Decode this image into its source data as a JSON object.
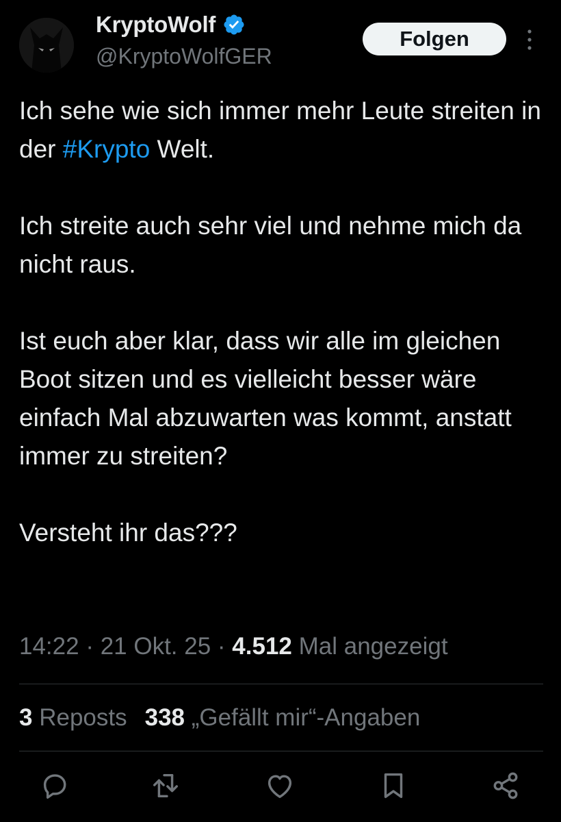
{
  "author": {
    "display_name": "KryptoWolf",
    "handle": "@KryptoWolfGER",
    "verified": true,
    "verified_color": "#1d9bf0"
  },
  "follow_button": {
    "label": "Folgen"
  },
  "tweet": {
    "paragraphs": [
      {
        "before": "Ich sehe wie sich immer mehr Leute streiten in der ",
        "hashtag": "#Krypto",
        "after": " Welt."
      },
      {
        "text": "Ich streite auch sehr viel und nehme mich da nicht raus."
      },
      {
        "text": "Ist euch aber klar, dass wir alle im gleichen Boot sitzen und es vielleicht besser wäre einfach Mal abzuwarten was kommt, anstatt immer zu streiten?"
      },
      {
        "text": "Versteht ihr das???"
      }
    ]
  },
  "meta": {
    "time": "14:22",
    "separator": " · ",
    "date": "21 Okt. 25",
    "views_count": "4.512",
    "views_label": "Mal angezeigt"
  },
  "stats": {
    "reposts_count": "3",
    "reposts_label": "Reposts",
    "likes_count": "338",
    "likes_label": "„Gefällt mir“-Angaben"
  },
  "actions": [
    {
      "name": "reply-icon"
    },
    {
      "name": "repost-icon"
    },
    {
      "name": "like-icon"
    },
    {
      "name": "bookmark-icon"
    },
    {
      "name": "share-icon"
    }
  ],
  "colors": {
    "background": "#000000",
    "text": "#e7e9ea",
    "secondary": "#71767b",
    "accent": "#1d9bf0",
    "divider": "#2f3336"
  }
}
